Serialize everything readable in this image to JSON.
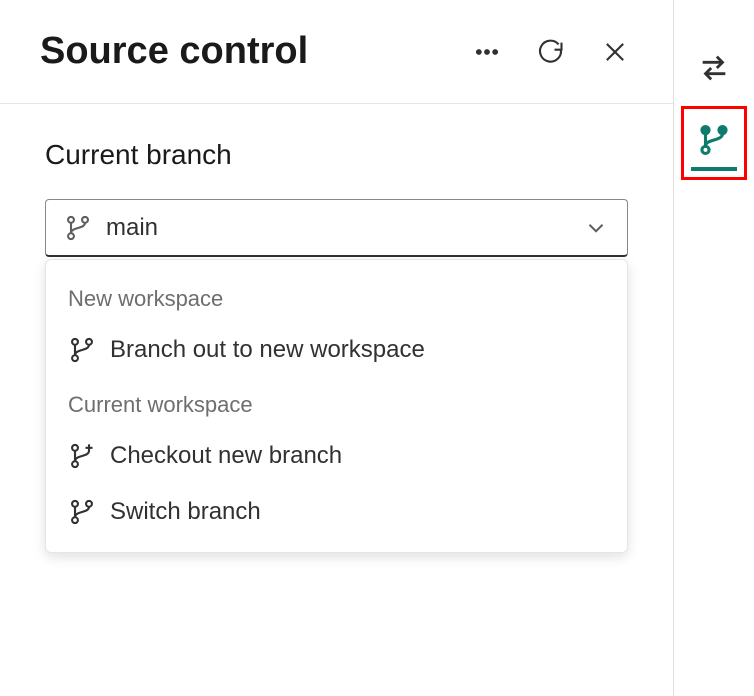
{
  "header": {
    "title": "Source control"
  },
  "section": {
    "label": "Current branch",
    "selected": "main"
  },
  "menu": {
    "groups": [
      {
        "label": "New workspace",
        "items": [
          {
            "label": "Branch out to new workspace",
            "icon": "branch"
          }
        ]
      },
      {
        "label": "Current workspace",
        "items": [
          {
            "label": "Checkout new branch",
            "icon": "branch-plus"
          },
          {
            "label": "Switch branch",
            "icon": "branch"
          }
        ]
      }
    ]
  },
  "colors": {
    "accent": "#0f7b6c"
  }
}
